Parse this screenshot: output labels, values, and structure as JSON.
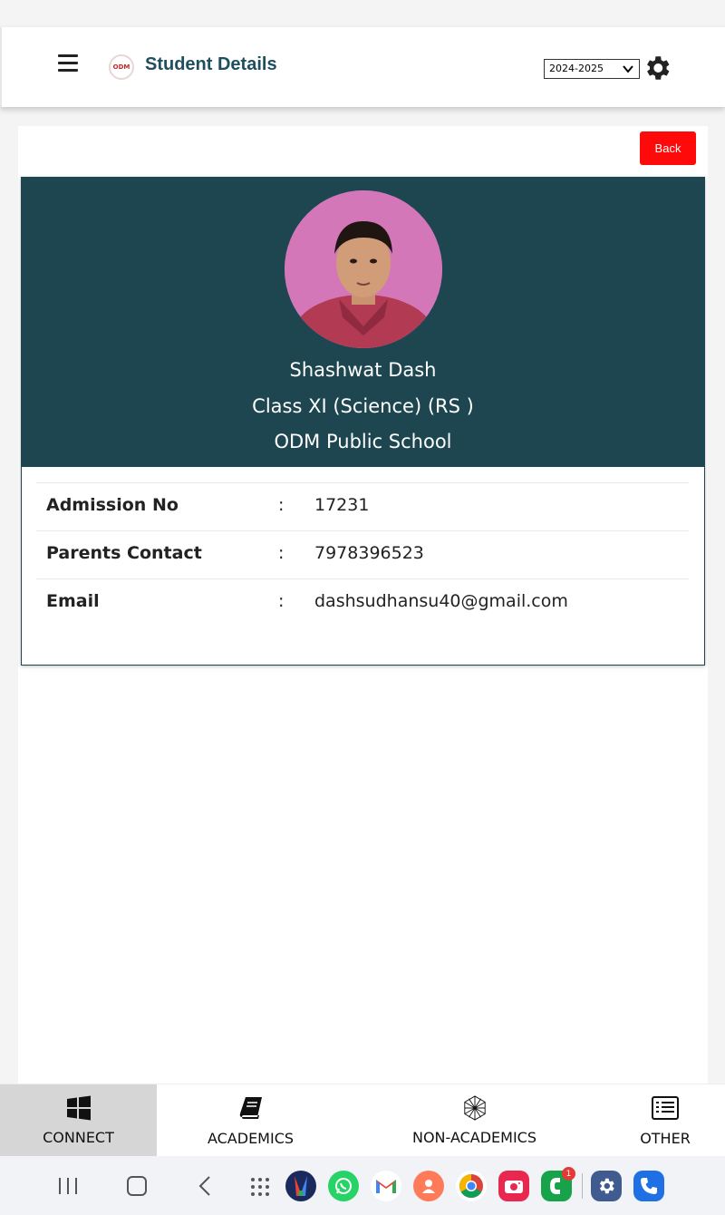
{
  "header": {
    "title": "Student Details",
    "logo_text": "ODM",
    "year_selected": "2024-2025"
  },
  "actions": {
    "back_label": "Back"
  },
  "profile": {
    "name": "Shashwat Dash",
    "class": "Class XI (Science) (RS )",
    "school": "ODM Public School"
  },
  "details": [
    {
      "label": "Admission No",
      "colon": ":",
      "value": "17231"
    },
    {
      "label": "Parents Contact",
      "colon": ":",
      "value": "7978396523"
    },
    {
      "label": "Email",
      "colon": ":",
      "value": "dashsudhansu40@gmail.com"
    }
  ],
  "bottom_nav": {
    "connect": "CONNECT",
    "academics": "ACADEMICS",
    "non_academics": "NON-ACADEMICS",
    "other": "OTHER",
    "active": "CONNECT"
  },
  "android": {
    "badge_count": "1",
    "apps": [
      "app-drawer-icon",
      "google-news-icon",
      "whatsapp-icon",
      "gmail-icon",
      "contacts-icon",
      "chrome-icon",
      "camera-icon",
      "phone-green-icon",
      "settings-icon",
      "phone-icon"
    ]
  },
  "colors": {
    "header_title": "#1f4e5f",
    "profile_bg": "#1d4650",
    "back_button": "#ff0a0a",
    "active_tab": "#d6d6d6"
  }
}
